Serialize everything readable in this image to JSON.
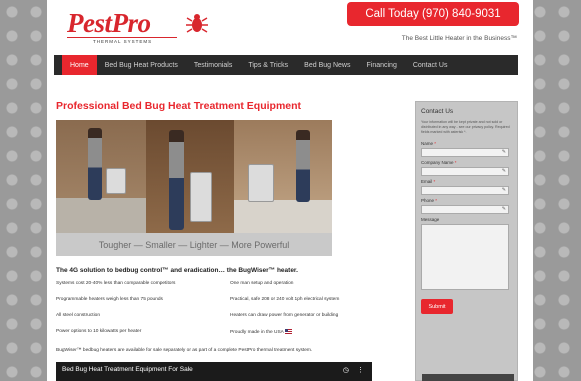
{
  "header": {
    "logo_text": "PestPro",
    "logo_sub": "THERMAL SYSTEMS",
    "call_button": "Call Today (970) 840-9031",
    "tagline": "The Best Little Heater in the Business™"
  },
  "nav": {
    "items": [
      {
        "label": "Home"
      },
      {
        "label": "Bed Bug Heat Products"
      },
      {
        "label": "Testimonials"
      },
      {
        "label": "Tips & Tricks"
      },
      {
        "label": "Bed Bug News"
      },
      {
        "label": "Financing"
      },
      {
        "label": "Contact Us"
      }
    ]
  },
  "main": {
    "headline": "Professional Bed Bug Heat Treatment Equipment",
    "hero_caption": "Tougher — Smaller — Lighter — More Powerful",
    "subhead": "The 4G solution to bedbug control™ and eradication… the BugWiser™ heater.",
    "features_left": [
      "Systems cost 20-40% less than comparable competitors",
      "Programmable heaters weigh less than 75 pounds",
      "All steel construction",
      "Power options to 10 kilowatts per heater"
    ],
    "features_right": [
      "One man setup and operation",
      "Practical, safe 208 or 240 volt 1ph electrical system",
      "Heaters can draw power from generator or building",
      "Proudly made in the USA"
    ],
    "availability": "BugWiser™ bedbug heaters are available for sale separately or as part of a complete PestPro thermal treatment system.",
    "video_title": "Bed Bug Heat Treatment Equipment For Sale"
  },
  "contact": {
    "title": "Contact Us",
    "note": "Your information will be kept private and not sold or distributed in any way - see our privacy policy. Required fields marked with asterisk *.",
    "fields": [
      {
        "label": "Name",
        "required": "*"
      },
      {
        "label": "Company Name",
        "required": "*"
      },
      {
        "label": "Email",
        "required": "*"
      },
      {
        "label": "Phone",
        "required": "*"
      }
    ],
    "message_label": "Message",
    "submit_label": "Submit"
  },
  "colors": {
    "accent": "#e8272e",
    "nav_bg": "#2a2a2a",
    "sidebar_bg": "#c6c6c6"
  }
}
